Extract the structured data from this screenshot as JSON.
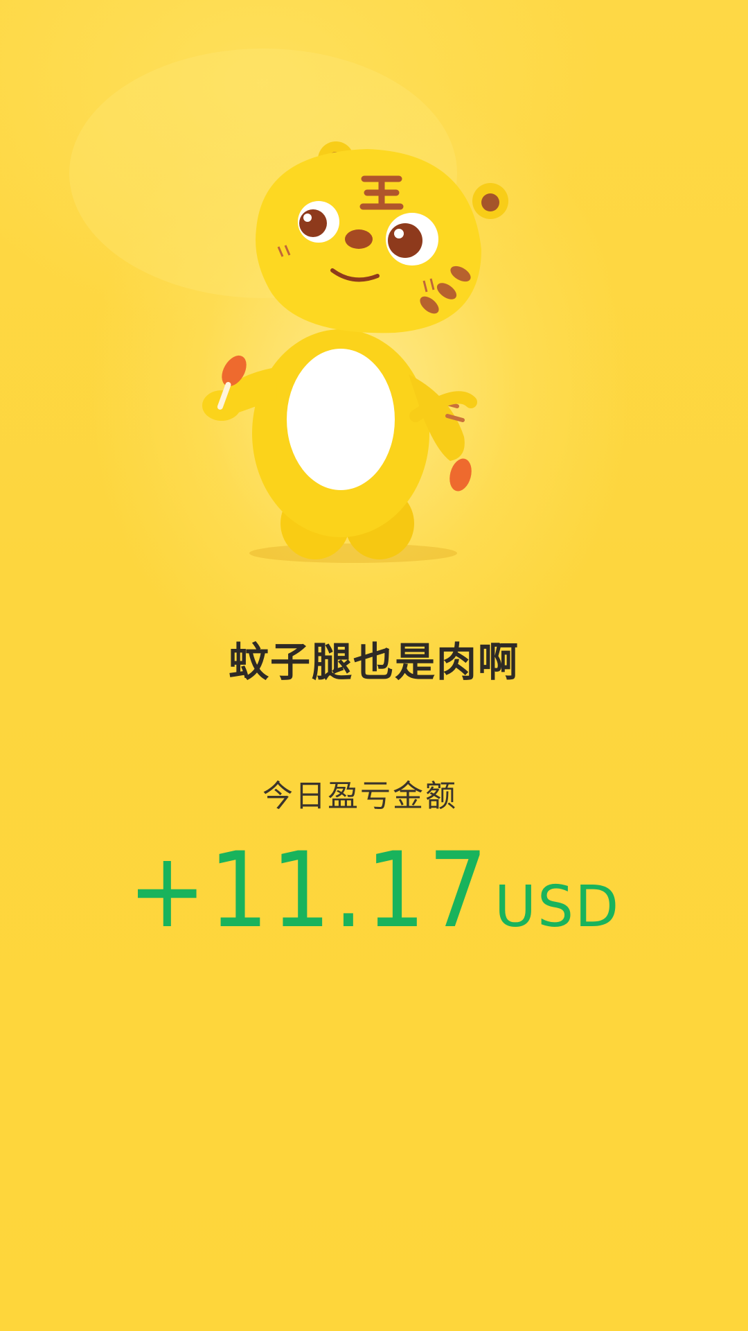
{
  "slogan": "蚊子腿也是肉啊",
  "daily_pnl": {
    "label": "今日盈亏金额",
    "amount": "+11.17",
    "currency": "USD",
    "color": "#19B35C"
  },
  "mascot": {
    "icon": "tiger-mascot-icon"
  }
}
